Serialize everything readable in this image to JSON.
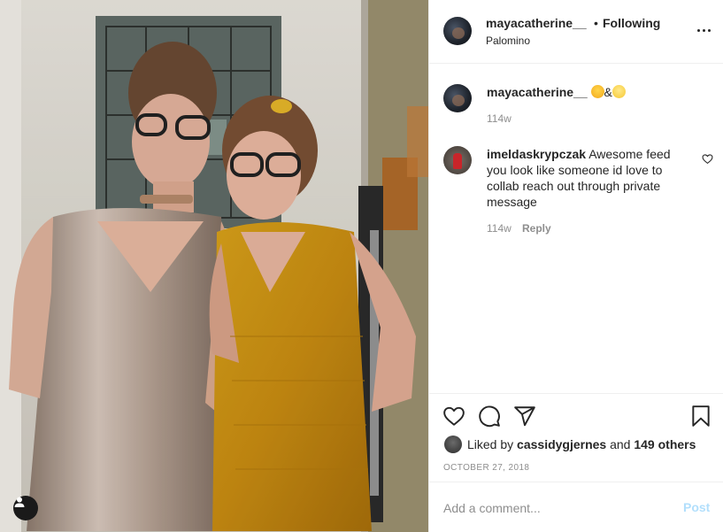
{
  "post": {
    "username": "mayacatherine__",
    "dot": "•",
    "follow_status": "Following",
    "location": "Palomino",
    "caption_username": "mayacatherine__",
    "caption_emojis": [
      "grinning-face-with-hand",
      "ampersand",
      "hugging-face"
    ],
    "caption_amp": "&",
    "caption_time": "114w"
  },
  "comments": [
    {
      "username": "imeldaskrypczak",
      "text": "Awesome feed you look like someone id love to collab reach out through private message",
      "time": "114w",
      "reply_label": "Reply"
    }
  ],
  "likes": {
    "prefix": "Liked by",
    "first_liker": "cassidygjernes",
    "and": "and",
    "others": "149 others"
  },
  "date": "OCTOBER 27, 2018",
  "composer": {
    "placeholder": "Add a comment...",
    "post_label": "Post"
  },
  "colors": {
    "text": "#262626",
    "muted": "#8e8e8e",
    "post_disabled": "#b2dffc",
    "divider": "#efefef"
  },
  "icons": [
    "more-options-icon",
    "heart-icon",
    "comment-icon",
    "share-icon",
    "bookmark-icon",
    "user-tag-icon",
    "comment-like-heart-icon"
  ]
}
